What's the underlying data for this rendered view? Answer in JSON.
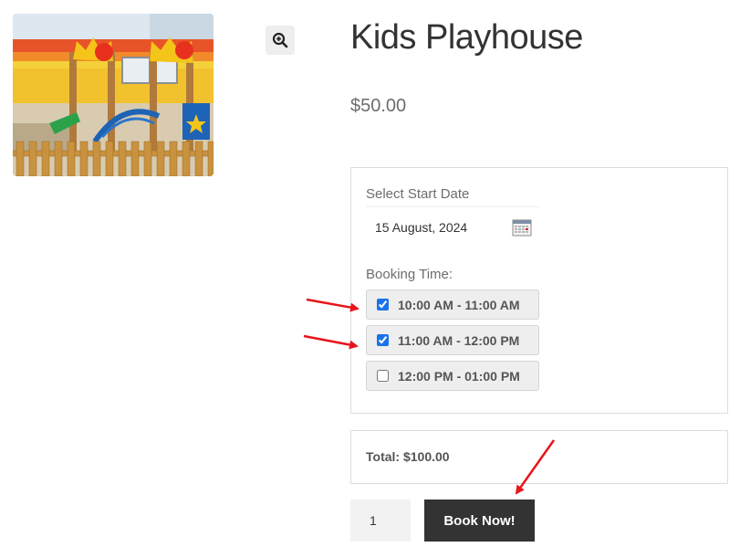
{
  "product": {
    "title": "Kids Playhouse",
    "price": "$50.00",
    "image_alt": "playground",
    "zoom_icon": "magnifier-plus-icon"
  },
  "booking": {
    "start_date_label": "Select Start Date",
    "start_date_value": "15 August, 2024",
    "calendar_icon": "calendar-icon",
    "booking_time_label": "Booking Time:",
    "slots": [
      {
        "label": "10:00 AM - 11:00 AM",
        "checked": true
      },
      {
        "label": "11:00 AM - 12:00 PM",
        "checked": true
      },
      {
        "label": "12:00 PM - 01:00 PM",
        "checked": false
      }
    ]
  },
  "total": {
    "text": "Total: $100.00"
  },
  "cart": {
    "quantity": "1",
    "book_button_label": "Book Now!"
  },
  "colors": {
    "annotation_arrow": "#e8141b",
    "checkbox_accent": "#1a73e8",
    "button_bg": "#333333"
  }
}
